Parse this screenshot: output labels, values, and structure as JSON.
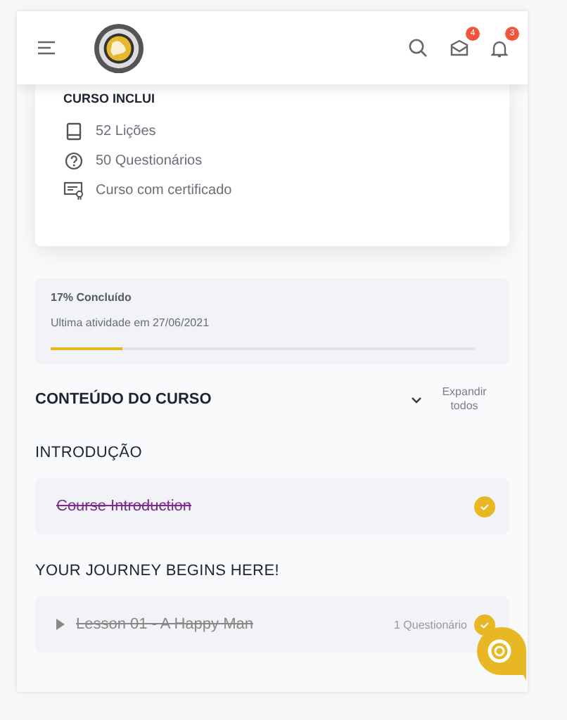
{
  "header": {
    "messages_badge": "4",
    "notifications_badge": "3"
  },
  "includes": {
    "title": "CURSO INCLUI",
    "items": [
      {
        "kind": "lessons",
        "label": "52 Lições"
      },
      {
        "kind": "quizzes",
        "label": "50 Questionários"
      },
      {
        "kind": "certificate",
        "label": "Curso com certificado"
      }
    ]
  },
  "progress": {
    "label": "17% Concluído",
    "last_activity": "Ultima atividade em 27/06/2021",
    "level": 0.17
  },
  "content": {
    "title": "CONTEÚDO DO CURSO",
    "expand_label": "Expandir todos"
  },
  "sections": [
    {
      "title": "INTRODUÇÃO",
      "items": [
        {
          "kind": "topic",
          "title": "Course Introduction",
          "completed": true
        }
      ]
    },
    {
      "title": "YOUR JOURNEY BEGINS HERE!",
      "items": [
        {
          "kind": "lesson",
          "title": "Lesson 01 - A Happy Man",
          "meta": "1 Questionário",
          "completed": true
        }
      ]
    }
  ]
}
